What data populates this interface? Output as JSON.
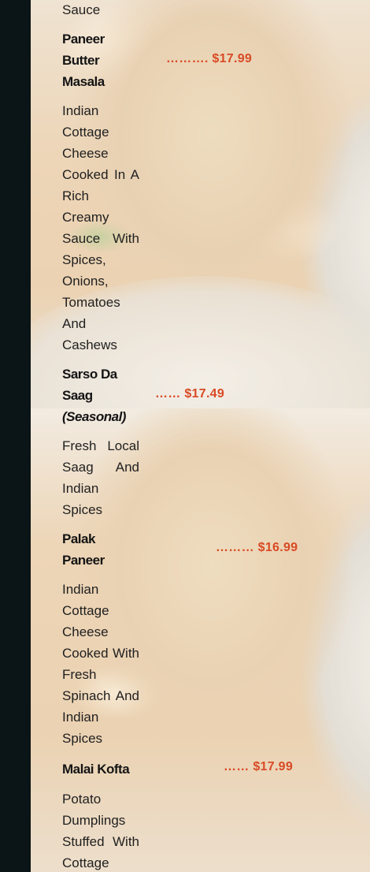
{
  "menu": {
    "top_fragment": "Sauce",
    "items": [
      {
        "name": "Paneer Butter Masala",
        "price": "………. $17.99",
        "description": "Indian Cottage Cheese Cooked In A Rich Creamy Sauce With Spices, Onions, Tomatoes And Cashews"
      },
      {
        "name": "Sarso Da Saag",
        "tag": "(Seasonal)",
        "price": "…… $17.49",
        "description": "Fresh Local Saag And Indian Spices"
      },
      {
        "name": "Palak Paneer",
        "price": "……… $16.99",
        "description": "Indian Cottage Cheese Cooked With Fresh Spinach And Indian Spices"
      },
      {
        "name": "Malai Kofta",
        "price": "…… $17.99",
        "description": "Potato Dumplings Stuffed With Cottage"
      }
    ]
  },
  "colors": {
    "price": "#d94a25",
    "sidebar": "#0b1416",
    "text": "#1f1f1f"
  }
}
